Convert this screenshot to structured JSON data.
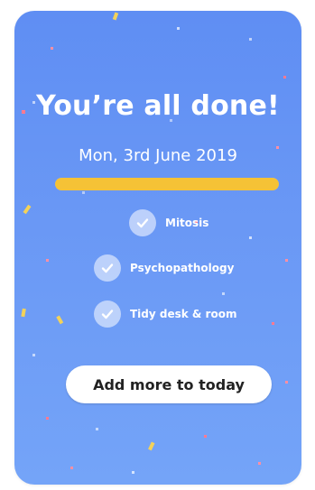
{
  "summary": {
    "title": "You’re all done!",
    "date": "Mon, 3rd June 2019",
    "progress": 1.0
  },
  "tasks": [
    {
      "label": "Mitosis",
      "done": true
    },
    {
      "label": "Psychopathology",
      "done": true
    },
    {
      "label": "Tidy desk & room",
      "done": true
    }
  ],
  "actions": {
    "add_more_label": "Add more to today"
  },
  "colors": {
    "background": "#6a98f5",
    "progress_fill": "#f5c236",
    "button_bg": "#ffffff",
    "text": "#ffffff"
  }
}
